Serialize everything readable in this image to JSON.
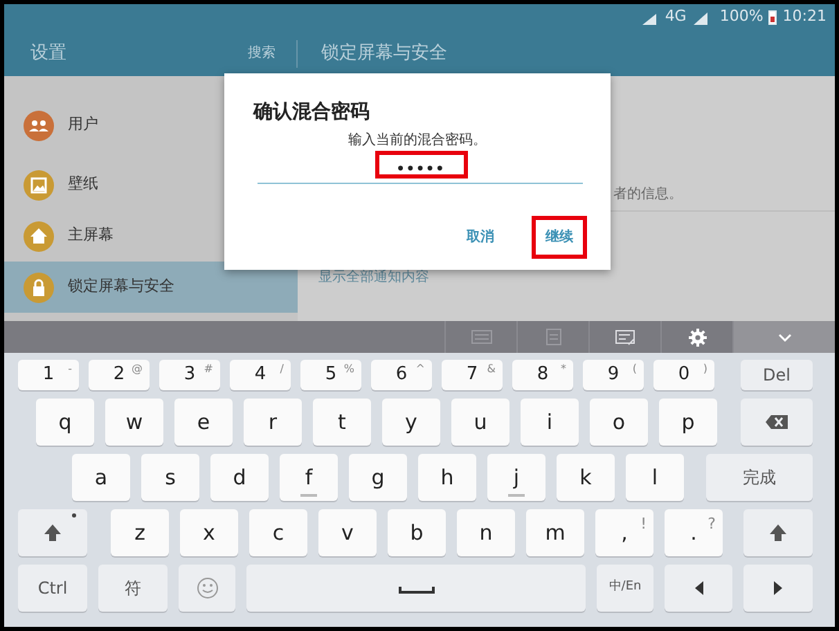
{
  "status_bar": {
    "network": "4G",
    "battery": "100%",
    "time": "10:21"
  },
  "header": {
    "title": "设置",
    "search": "搜索",
    "page_title": "锁定屏幕与安全"
  },
  "sidebar": {
    "items": [
      {
        "label": "用户",
        "color": "#c9703a",
        "selected": false
      },
      {
        "label": "壁纸",
        "color": "#c99a34",
        "selected": false
      },
      {
        "label": "主屏幕",
        "color": "#c99a34",
        "selected": false
      },
      {
        "label": "锁定屏幕与安全",
        "color": "#c99a34",
        "selected": true
      }
    ]
  },
  "content": {
    "partial_text": "者的信息。",
    "link": "显示全部通知内容"
  },
  "dialog": {
    "title": "确认混合密码",
    "message": "输入当前的混合密码。",
    "value": "•••••",
    "highlight_field": true,
    "buttons": [
      {
        "label": "取消",
        "highlighted": false
      },
      {
        "label": "继续",
        "highlighted": true
      }
    ]
  },
  "keyboard": {
    "rows": [
      {
        "keys": [
          {
            "kind": "digit",
            "label": "1",
            "alt": "-"
          },
          {
            "kind": "digit",
            "label": "2",
            "alt": "@"
          },
          {
            "kind": "digit",
            "label": "3",
            "alt": "#"
          },
          {
            "kind": "digit",
            "label": "4",
            "alt": "/"
          },
          {
            "kind": "digit",
            "label": "5",
            "alt": "%"
          },
          {
            "kind": "digit",
            "label": "6",
            "alt": "^"
          },
          {
            "kind": "digit",
            "label": "7",
            "alt": "&"
          },
          {
            "kind": "digit",
            "label": "8",
            "alt": "*"
          },
          {
            "kind": "digit",
            "label": "9",
            "alt": "("
          },
          {
            "kind": "digit",
            "label": "0",
            "alt": ")"
          },
          {
            "kind": "del",
            "label": "Del"
          }
        ]
      },
      {
        "keys": [
          {
            "kind": "letter",
            "label": "q"
          },
          {
            "kind": "letter",
            "label": "w"
          },
          {
            "kind": "letter",
            "label": "e"
          },
          {
            "kind": "letter",
            "label": "r"
          },
          {
            "kind": "letter",
            "label": "t"
          },
          {
            "kind": "letter",
            "label": "y"
          },
          {
            "kind": "letter",
            "label": "u"
          },
          {
            "kind": "letter",
            "label": "i"
          },
          {
            "kind": "letter",
            "label": "o"
          },
          {
            "kind": "letter",
            "label": "p"
          },
          {
            "kind": "backspace"
          }
        ]
      },
      {
        "keys": [
          {
            "kind": "letter",
            "label": "a"
          },
          {
            "kind": "letter",
            "label": "s"
          },
          {
            "kind": "letter",
            "label": "d"
          },
          {
            "kind": "letter",
            "label": "f",
            "homing": true
          },
          {
            "kind": "letter",
            "label": "g"
          },
          {
            "kind": "letter",
            "label": "h"
          },
          {
            "kind": "letter",
            "label": "j",
            "homing": true
          },
          {
            "kind": "letter",
            "label": "k"
          },
          {
            "kind": "letter",
            "label": "l"
          },
          {
            "kind": "done",
            "label": "完成"
          }
        ]
      },
      {
        "keys": [
          {
            "kind": "shift",
            "dot": true
          },
          {
            "kind": "letter",
            "label": "z"
          },
          {
            "kind": "letter",
            "label": "x"
          },
          {
            "kind": "letter",
            "label": "c"
          },
          {
            "kind": "letter",
            "label": "v"
          },
          {
            "kind": "letter",
            "label": "b"
          },
          {
            "kind": "letter",
            "label": "n"
          },
          {
            "kind": "letter",
            "label": "m"
          },
          {
            "kind": "letter",
            "label": ",",
            "alt": "!"
          },
          {
            "kind": "letter",
            "label": ".",
            "alt": "?"
          },
          {
            "kind": "shift",
            "dot": false
          }
        ]
      },
      {
        "keys": [
          {
            "kind": "ctrl",
            "label": "Ctrl"
          },
          {
            "kind": "symbol",
            "label": "符"
          },
          {
            "kind": "emoji"
          },
          {
            "kind": "space"
          },
          {
            "kind": "lang",
            "label": "中/En"
          },
          {
            "kind": "left"
          },
          {
            "kind": "right"
          }
        ]
      }
    ]
  }
}
